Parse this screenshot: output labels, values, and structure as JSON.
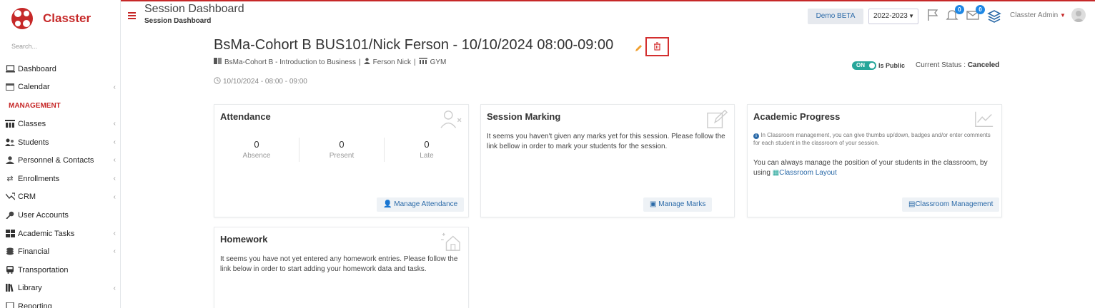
{
  "app": {
    "name": "Classter"
  },
  "sidebar": {
    "search_placeholder": "Search...",
    "items_top": [
      {
        "label": "Dashboard",
        "icon": "laptop-icon",
        "chevron": false
      },
      {
        "label": "Calendar",
        "icon": "calendar-icon",
        "chevron": true
      }
    ],
    "section_label": "MANAGEMENT",
    "items": [
      {
        "label": "Classes",
        "icon": "classes-icon",
        "chevron": true
      },
      {
        "label": "Students",
        "icon": "students-icon",
        "chevron": true
      },
      {
        "label": "Personnel & Contacts",
        "icon": "personnel-icon",
        "chevron": true
      },
      {
        "label": "Enrollments",
        "icon": "exchange-icon",
        "chevron": true
      },
      {
        "label": "CRM",
        "icon": "crm-icon",
        "chevron": true
      },
      {
        "label": "User Accounts",
        "icon": "key-icon",
        "chevron": false
      },
      {
        "label": "Academic Tasks",
        "icon": "tasks-icon",
        "chevron": true
      },
      {
        "label": "Financial",
        "icon": "coins-icon",
        "chevron": true
      },
      {
        "label": "Transportation",
        "icon": "bus-icon",
        "chevron": false
      },
      {
        "label": "Library",
        "icon": "books-icon",
        "chevron": true
      },
      {
        "label": "Reporting",
        "icon": "report-icon",
        "chevron": false
      }
    ]
  },
  "header": {
    "title": "Session Dashboard",
    "breadcrumb": "Session Dashboard",
    "demo_label": "Demo BETA",
    "year": "2022-2023",
    "notif_count": "0",
    "mail_count": "0",
    "user_name": "Classter Admin"
  },
  "session": {
    "title": "BsMa-Cohort B BUS101/Nick Ferson - 10/10/2024 08:00-09:00",
    "course": "BsMa-Cohort B - Introduction to Business",
    "teacher": "Ferson Nick",
    "room": "GYM",
    "time": "10/10/2024 - 08:00 - 09:00",
    "toggle_label": "ON",
    "is_public_label": "Is Public",
    "status_label": "Current Status :",
    "status_value": "Canceled"
  },
  "cards": {
    "attendance": {
      "title": "Attendance",
      "stats": [
        {
          "value": "0",
          "label": "Absence"
        },
        {
          "value": "0",
          "label": "Present"
        },
        {
          "value": "0",
          "label": "Late"
        }
      ],
      "button": "Manage Attendance"
    },
    "marking": {
      "title": "Session Marking",
      "text": "It seems you haven't given any marks yet for this session. Please follow the link bellow in order to mark your students for the session.",
      "button": "Manage Marks"
    },
    "progress": {
      "title": "Academic Progress",
      "info": "In Classroom management, you can give thumbs up/down, badges and/or enter comments for each student in the classroom of your session.",
      "text_before": "You can always manage the position of your students in the classroom, by using",
      "link": "Classroom Layout",
      "button": "Classroom Management"
    },
    "homework": {
      "title": "Homework",
      "text": "It seems you have not yet entered any homework entries. Please follow the link below in order to start adding your homework data and tasks."
    }
  },
  "colors": {
    "brand": "#c62828",
    "accent": "#2b6aa8",
    "toggle": "#26a69a"
  }
}
